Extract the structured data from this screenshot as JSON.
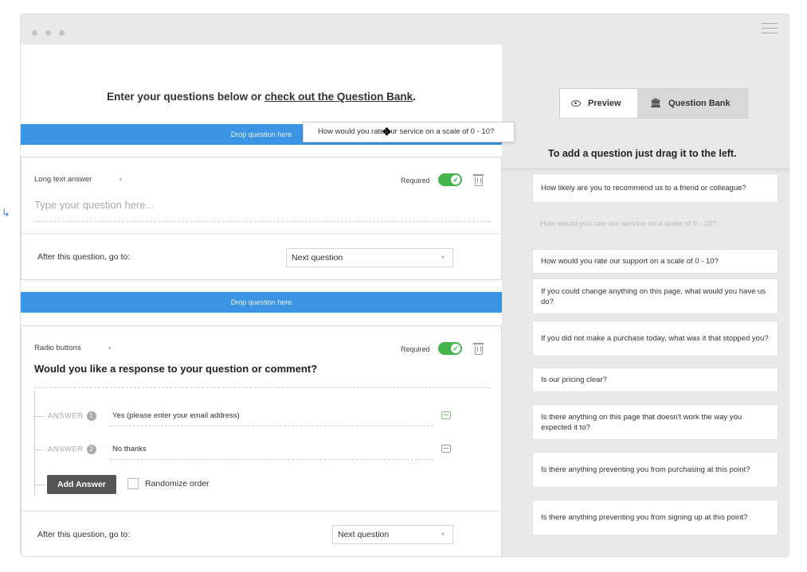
{
  "editor": {
    "intro_prefix": "Enter your questions below or ",
    "intro_link": "check out the Question Bank",
    "intro_suffix": ".",
    "drop_label": "Drop question here",
    "required_label": "Required",
    "goto_label": "After this question, go to:",
    "questions": [
      {
        "type": "Long text answer",
        "placeholder": "Type your question here...",
        "goto_value": "Next question"
      },
      {
        "type": "Radio buttons",
        "text": "Would you like a response to your question or comment?",
        "answer_label": "ANSWER",
        "answers": [
          {
            "num": "1",
            "value": "Yes (please enter your email address)"
          },
          {
            "num": "2",
            "value": "No thanks"
          }
        ],
        "add_answer_label": "Add Answer",
        "randomize_label": "Randomize order",
        "goto_value": "Next question"
      }
    ]
  },
  "drag_ghost": "How would you rate our service on a scale of 0 - 10?",
  "panel": {
    "tab_preview": "Preview",
    "tab_bank": "Question Bank",
    "hint": "To add a question just drag it to the left.",
    "items": [
      "How likely are you to recommend us to a friend or colleague?",
      "How would you rate our service on a scale of 0 - 10?",
      "How would you rate our support on a scale of 0 - 10?",
      "If you could change anything on this page, what would you have us do?",
      "If you did not make a purchase today, what was it that stopped you?",
      "Is our pricing clear?",
      "Is there anything on this page that doesn't work the way you expected it to?",
      "Is there anything preventing you from purchasing at this point?",
      "Is there anything preventing you from signing up at this point?"
    ]
  },
  "icons": {
    "preview": "eye-icon",
    "bank": "bank-icon",
    "delete": "trash-icon",
    "comment": "comment-icon",
    "menu": "hamburger-icon",
    "cursor": "move-cursor-icon"
  },
  "colors": {
    "drop_zone": "#3b94e4",
    "toggle_on": "#45b44a",
    "add_answer_button": "#555555"
  }
}
